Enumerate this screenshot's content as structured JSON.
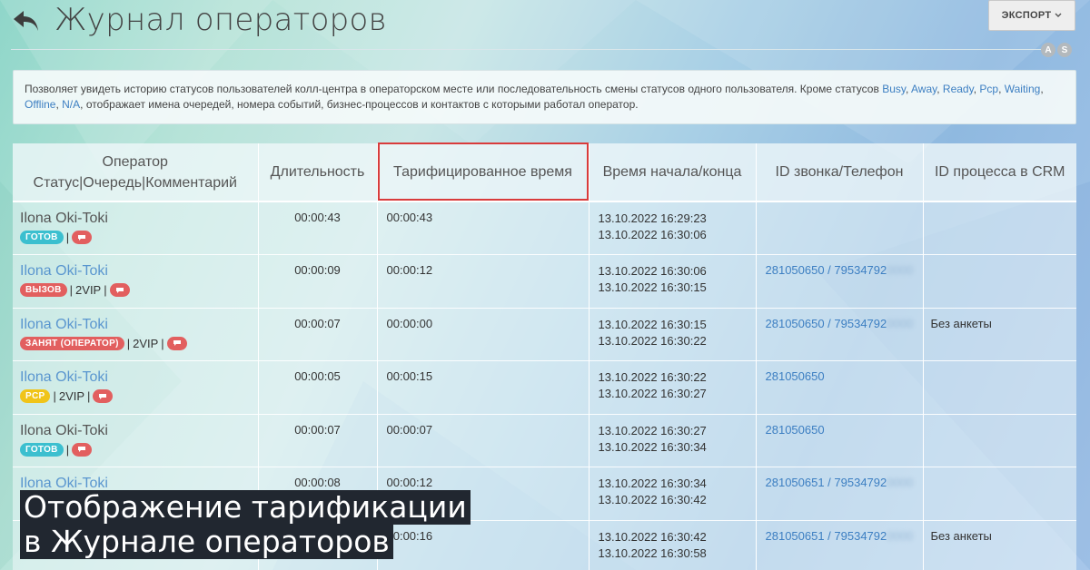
{
  "header": {
    "title": "Журнал операторов",
    "export_label": "ЭКСПОРТ",
    "badge_a": "A",
    "badge_s": "S"
  },
  "info": {
    "text_1": "Позволяет увидеть историю статусов пользователей колл-центра в операторском месте или последовательность смены статусов одного пользователя. Кроме статусов ",
    "busy": "Busy",
    "away": "Away",
    "ready": "Ready",
    "pcp": "Pcp",
    "waiting": "Waiting",
    "offline": "Offline",
    "na": "N/A",
    "text_2": ", отображает имена очередей, номера событий, бизнес-процессов и контактов с которыми работал оператор."
  },
  "table": {
    "headers": {
      "operator_line1": "Оператор",
      "operator_line2": "Статус|Очередь|Комментарий",
      "duration": "Длительность",
      "tariffed": "Тарифицированное время",
      "start_end": "Время начала/конца",
      "call_id": "ID звонка/Телефон",
      "crm_id": "ID процесса в CRM"
    },
    "rows": [
      {
        "name": "Ilona Oki-Toki",
        "status": "ГОТОВ",
        "queue": "",
        "duration": "00:00:43",
        "tariffed": "00:00:43",
        "start": "13.10.2022 16:29:23",
        "end": "13.10.2022 16:30:06",
        "call": "",
        "phone": "",
        "crm": ""
      },
      {
        "name": "Ilona Oki-Toki",
        "status": "ВЫЗОВ",
        "queue": "2VIP",
        "duration": "00:00:09",
        "tariffed": "00:00:12",
        "start": "13.10.2022 16:30:06",
        "end": "13.10.2022 16:30:15",
        "call": "281050650 / 79534792",
        "phone": "0000",
        "crm": ""
      },
      {
        "name": "Ilona Oki-Toki",
        "status": "ЗАНЯТ (ОПЕРАТОР)",
        "queue": "2VIP",
        "duration": "00:00:07",
        "tariffed": "00:00:00",
        "start": "13.10.2022 16:30:15",
        "end": "13.10.2022 16:30:22",
        "call": "281050650 / 79534792",
        "phone": "0000",
        "crm": "Без анкеты"
      },
      {
        "name": "Ilona Oki-Toki",
        "status": "PCP",
        "queue": "2VIP",
        "duration": "00:00:05",
        "tariffed": "00:00:15",
        "start": "13.10.2022 16:30:22",
        "end": "13.10.2022 16:30:27",
        "call": "281050650",
        "phone": "",
        "crm": ""
      },
      {
        "name": "Ilona Oki-Toki",
        "status": "ГОТОВ",
        "queue": "",
        "duration": "00:00:07",
        "tariffed": "00:00:07",
        "start": "13.10.2022 16:30:27",
        "end": "13.10.2022 16:30:34",
        "call": "281050650",
        "phone": "",
        "crm": ""
      },
      {
        "name": "Ilona Oki-Toki",
        "status": "",
        "queue": "",
        "duration": "00:00:08",
        "tariffed": "00:00:12",
        "start": "13.10.2022 16:30:34",
        "end": "13.10.2022 16:30:42",
        "call": "281050651 / 79534792",
        "phone": "0000",
        "crm": ""
      },
      {
        "name": "",
        "status": "",
        "queue": "",
        "duration": "",
        "tariffed": "00:00:16",
        "start": "13.10.2022 16:30:42",
        "end": "13.10.2022 16:30:58",
        "call": "281050651 / 79534792",
        "phone": "0000",
        "crm": "Без анкеты"
      }
    ]
  },
  "caption": {
    "line1": "Отображение тарификации",
    "line2": "в Журнале операторов"
  }
}
